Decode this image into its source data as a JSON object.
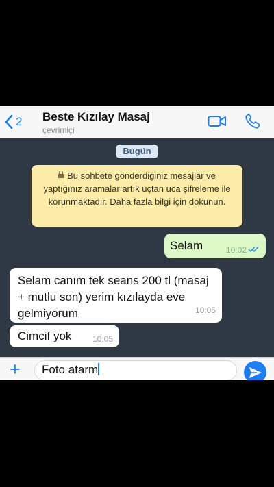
{
  "header": {
    "back_count": "2",
    "contact_name": "Beste Kızılay Masaj",
    "status": "çevrimiçi"
  },
  "chat": {
    "date_chip": "Bugün",
    "encryption_notice": "Bu sohbete gönderdiğiniz mesajlar ve yaptığınız aramalar artık uçtan uca şifreleme ile korunmaktadır. Daha fazla bilgi için dokunun.",
    "messages": [
      {
        "direction": "outgoing",
        "text": "Selam",
        "time": "10:02",
        "status": "read"
      },
      {
        "direction": "incoming",
        "text": "Selam canım tek seans 200 tl (masaj + mutlu son) yerim kızılayda eve gelmiyorum",
        "time": "10:05"
      },
      {
        "direction": "incoming",
        "text": "Cimcif yok",
        "time": "10:05"
      }
    ]
  },
  "composer": {
    "value": "Foto atarm"
  },
  "icons": [
    "back-chevron-icon",
    "video-call-icon",
    "phone-icon",
    "lock-icon",
    "double-check-icon",
    "plus-icon",
    "send-arrow-icon"
  ],
  "colors": {
    "accent": "#1e7ef0",
    "outgoing_bubble": "#dcf8c6",
    "notice_bubble": "#fcecaa",
    "chat_background": "#2f3843"
  }
}
